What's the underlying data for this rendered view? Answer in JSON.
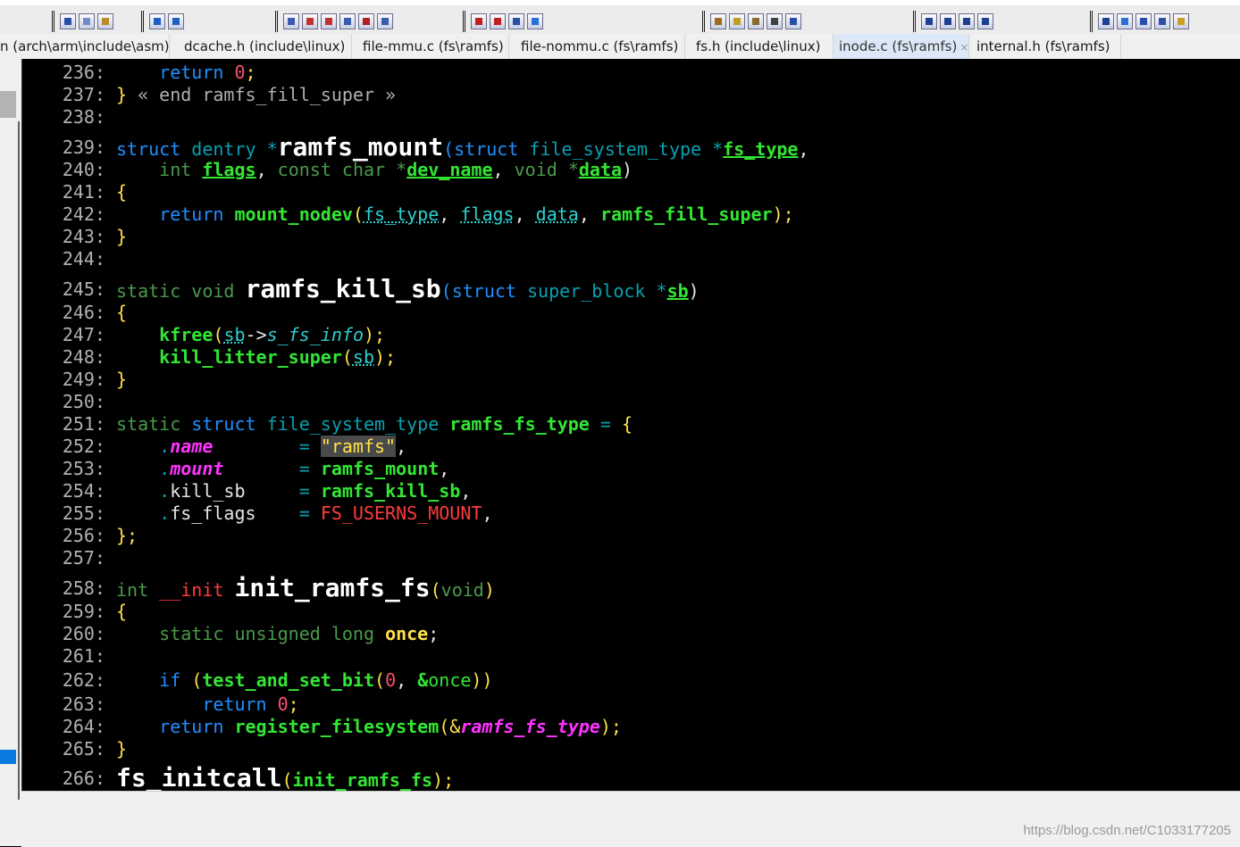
{
  "tabs": [
    {
      "label": "n (arch\\arm\\include\\asm)",
      "active": false
    },
    {
      "label": "dcache.h (include\\linux)",
      "active": false
    },
    {
      "label": "file-mmu.c (fs\\ramfs)",
      "active": false
    },
    {
      "label": "file-nommu.c (fs\\ramfs)",
      "active": false
    },
    {
      "label": "fs.h (include\\linux)",
      "active": false
    },
    {
      "label": "inode.c (fs\\ramfs)",
      "active": true
    },
    {
      "label": "internal.h (fs\\ramfs)",
      "active": false
    }
  ],
  "active_tab_close": "×",
  "toolbar_icons": [
    "save-icon",
    "copy-icon",
    "paste-icon",
    "undo-icon",
    "redo-icon",
    "find-icon",
    "jump-up-icon",
    "jump-down-icon",
    "find-files-icon",
    "replace-icon",
    "web-icon",
    "bookmark-prev-icon",
    "bookmark-next-icon",
    "bookmark-list-icon",
    "star-icon",
    "symbol-icon",
    "help-icon",
    "book-icon",
    "function-icon",
    "script-icon",
    "layout-1-icon",
    "layout-2-icon",
    "layout-3-icon",
    "window-icon",
    "project-icon",
    "tree-icon",
    "outline-icon",
    "list-icon",
    "folder-icon"
  ],
  "colors": {
    "keyword": "#1f90ff",
    "function": "#33e633",
    "string": "#ffe14a",
    "number": "#ff4d6d",
    "member": "#ff33ff",
    "background": "#000000"
  },
  "code": {
    "l236": {
      "num": "236:",
      "t1": "return",
      "t2": "0",
      "t3": ";"
    },
    "l237": {
      "num": "237:",
      "t1": "}",
      "t2": " « end ramfs_fill_super »"
    },
    "l238": {
      "num": "238:"
    },
    "l239": {
      "num": "239:",
      "t1": "struct",
      "t2": "dentry",
      "t3": "*",
      "t4": "ramfs_mount",
      "t5": "(",
      "t6": "struct",
      "t7": "file_system_type",
      "t8": "*",
      "t9": "fs_type",
      "t10": ","
    },
    "l240": {
      "num": "240:",
      "t1": "int",
      "t2": "flags",
      "t3": ",",
      "t4": "const",
      "t5": "char",
      "t6": "*",
      "t7": "dev_name",
      "t8": ",",
      "t9": "void",
      "t10": "*",
      "t11": "data",
      "t12": ")"
    },
    "l241": {
      "num": "241:",
      "t1": "{"
    },
    "l242": {
      "num": "242:",
      "t1": "return",
      "t2": "mount_nodev",
      "t3": "(",
      "t4": "fs_type",
      "t5": ",",
      "t6": "flags",
      "t7": ",",
      "t8": "data",
      "t9": ",",
      "t10": "ramfs_fill_super",
      "t11": ");"
    },
    "l243": {
      "num": "243:",
      "t1": "}"
    },
    "l244": {
      "num": "244:"
    },
    "l245": {
      "num": "245:",
      "t1": "static",
      "t2": "void",
      "t3": "ramfs_kill_sb",
      "t4": "(",
      "t5": "struct",
      "t6": "super_block",
      "t7": "*",
      "t8": "sb",
      "t9": ")"
    },
    "l246": {
      "num": "246:",
      "t1": "{"
    },
    "l247": {
      "num": "247:",
      "t1": "kfree",
      "t2": "(",
      "t3": "sb",
      "t4": "->",
      "t5": "s_fs_info",
      "t6": ");"
    },
    "l248": {
      "num": "248:",
      "t1": "kill_litter_super",
      "t2": "(",
      "t3": "sb",
      "t4": ");"
    },
    "l249": {
      "num": "249:",
      "t1": "}"
    },
    "l250": {
      "num": "250:"
    },
    "l251": {
      "num": "251:",
      "t1": "static",
      "t2": "struct",
      "t3": "file_system_type",
      "t4": "ramfs_fs_type",
      "t5": "=",
      "t6": "{"
    },
    "l252": {
      "num": "252:",
      "t1": ".",
      "t2": "name",
      "t3": "=",
      "t4": "\"ramfs\"",
      "t5": ","
    },
    "l253": {
      "num": "253:",
      "t1": ".",
      "t2": "mount",
      "t3": "=",
      "t4": "ramfs_mount",
      "t5": ","
    },
    "l254": {
      "num": "254:",
      "t1": ".",
      "t2": "kill_sb",
      "t3": "=",
      "t4": "ramfs_kill_sb",
      "t5": ","
    },
    "l255": {
      "num": "255:",
      "t1": ".",
      "t2": "fs_flags",
      "t3": "=",
      "t4": "FS_USERNS_MOUNT",
      "t5": ","
    },
    "l256": {
      "num": "256:",
      "t1": "};"
    },
    "l257": {
      "num": "257:"
    },
    "l258": {
      "num": "258:",
      "t1": "int",
      "t2": "__init",
      "t3": "init_ramfs_fs",
      "t4": "(",
      "t5": "void",
      "t6": ")"
    },
    "l259": {
      "num": "259:",
      "t1": "{"
    },
    "l260": {
      "num": "260:",
      "t1": "static",
      "t2": "unsigned",
      "t3": "long",
      "t4": "once",
      "t5": ";"
    },
    "l261": {
      "num": "261:"
    },
    "l262": {
      "num": "262:",
      "t1": "if",
      "t2": "(",
      "t3": "test_and_set_bit",
      "t4": "(",
      "t5": "0",
      "t6": ",",
      "t7": "&",
      "t8": "once",
      "t9": "))"
    },
    "l263": {
      "num": "263:",
      "t1": "return",
      "t2": "0",
      "t3": ";"
    },
    "l264": {
      "num": "264:",
      "t1": "return",
      "t2": "register_filesystem",
      "t3": "(&",
      "t4": "ramfs_fs_type",
      "t5": ");"
    },
    "l265": {
      "num": "265:",
      "t1": "}"
    },
    "l266": {
      "num": "266:",
      "t1": "fs_initcall",
      "t2": "(",
      "t3": "init_ramfs_fs",
      "t4": ");"
    }
  },
  "watermark": "https://blog.csdn.net/C1033177205"
}
